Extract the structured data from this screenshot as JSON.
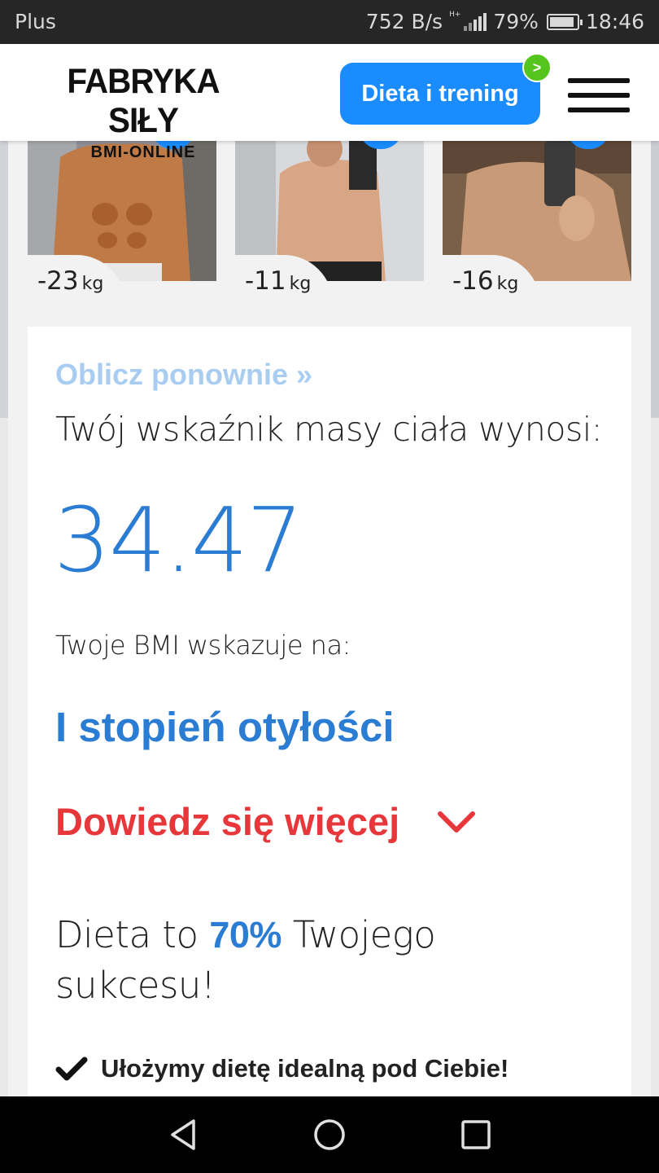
{
  "status_bar": {
    "carrier": "Plus",
    "speed": "752 B/s",
    "network": "H+",
    "battery_pct": "79%",
    "time": "18:46"
  },
  "header": {
    "logo_title": "FABRYKA SIŁY",
    "logo_subtitle": "BMI-ONLINE",
    "cta_label": "Dieta i trening",
    "cta_badge": ">",
    "menu_icon": "hamburger-menu-icon"
  },
  "transformations": [
    {
      "loss": "-23",
      "unit": "kg"
    },
    {
      "loss": "-11",
      "unit": "kg"
    },
    {
      "loss": "-16",
      "unit": "kg"
    }
  ],
  "result": {
    "recalc_link": "Oblicz ponownie »",
    "intro": "Twój wskaźnik masy ciała wynosi:",
    "bmi_value": "34.47",
    "indicates_label": "Twoje BMI wskazuje na:",
    "category": "I stopień otyłości",
    "learn_more": "Dowiedz się więcej",
    "diet_prefix": "Dieta to ",
    "diet_pct": "70%",
    "diet_suffix": " Twojego sukcesu!",
    "bullet_1": "Ułożymy dietę idealną pod Ciebie!"
  },
  "colors": {
    "accent_blue": "#1a8cff",
    "value_blue": "#2b7cd3",
    "link_light_blue": "#a8cdf0",
    "alert_red": "#e8373a",
    "badge_green": "#54c51c"
  },
  "nav_bar": {
    "back_icon": "back-triangle-icon",
    "home_icon": "home-circle-icon",
    "recents_icon": "recents-square-icon"
  }
}
